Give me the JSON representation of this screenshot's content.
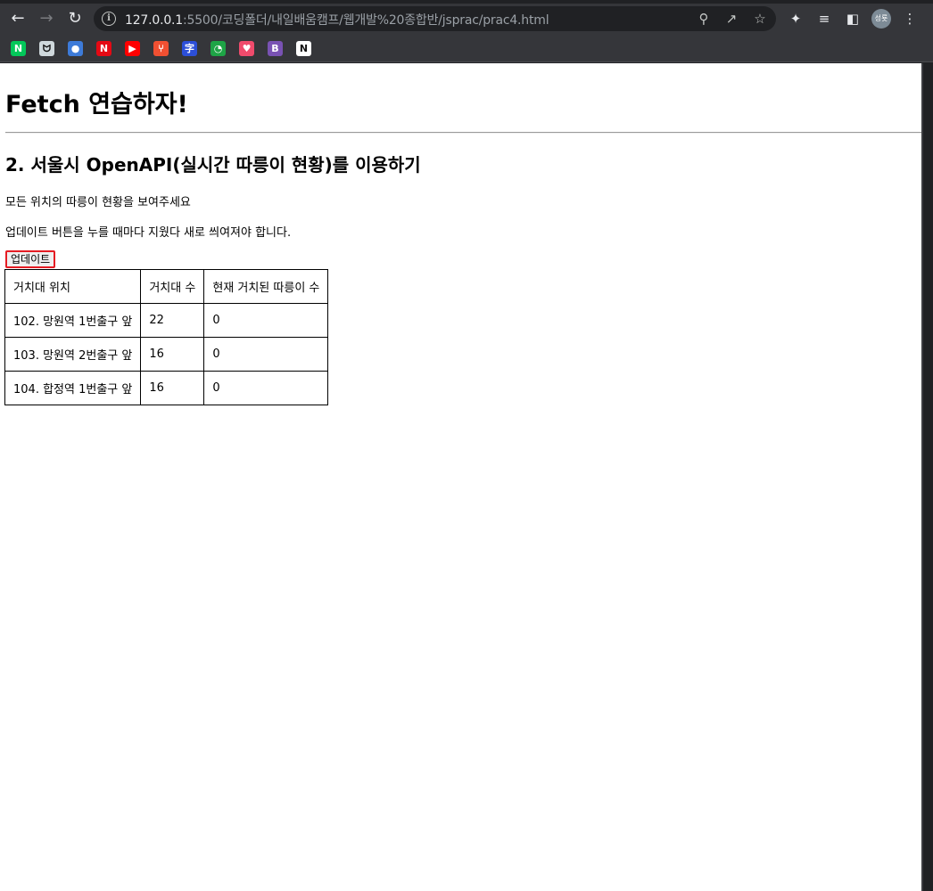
{
  "browser": {
    "url_host": "127.0.0.1",
    "url_path": ":5500/코딩폴더/내일배움캠프/웹개발%20종합반/jsprac/prac4.html",
    "avatar_label": "성룟",
    "bookmarks": [
      {
        "name": "naver",
        "glyph": "N",
        "color": "#03c75a"
      },
      {
        "name": "cat",
        "glyph": "ᗢ",
        "color": "#cfd8dc"
      },
      {
        "name": "game",
        "glyph": "●",
        "color": "#3d7bd9"
      },
      {
        "name": "netflix",
        "glyph": "N",
        "color": "#e50914"
      },
      {
        "name": "youtube",
        "glyph": "▶",
        "color": "#ff0000"
      },
      {
        "name": "git",
        "glyph": "⑂",
        "color": "#f05032"
      },
      {
        "name": "dict",
        "glyph": "字",
        "color": "#2c4fd8"
      },
      {
        "name": "clock",
        "glyph": "◔",
        "color": "#1ea446"
      },
      {
        "name": "heart",
        "glyph": "♥",
        "color": "#ef4b6c"
      },
      {
        "name": "bootstrap",
        "glyph": "B",
        "color": "#7952b3"
      },
      {
        "name": "notion",
        "glyph": "N",
        "color": "#ffffff"
      }
    ]
  },
  "page": {
    "title": "Fetch 연습하자!",
    "subtitle": "2. 서울시 OpenAPI(실시간 따릉이 현황)를 이용하기",
    "desc1": "모든 위치의 따릉이 현황을 보여주세요",
    "desc2": "업데이트 버튼을 누를 때마다 지웠다 새로 씌여져야 합니다.",
    "update_button": "업데이트",
    "table": {
      "headers": [
        "거치대 위치",
        "거치대 수",
        "현재 거치된 따릉이 수"
      ],
      "rows": [
        [
          "102. 망원역 1번출구 앞",
          "22",
          "0"
        ],
        [
          "103. 망원역 2번출구 앞",
          "16",
          "0"
        ],
        [
          "104. 합정역 1번출구 앞",
          "16",
          "0"
        ]
      ]
    }
  }
}
